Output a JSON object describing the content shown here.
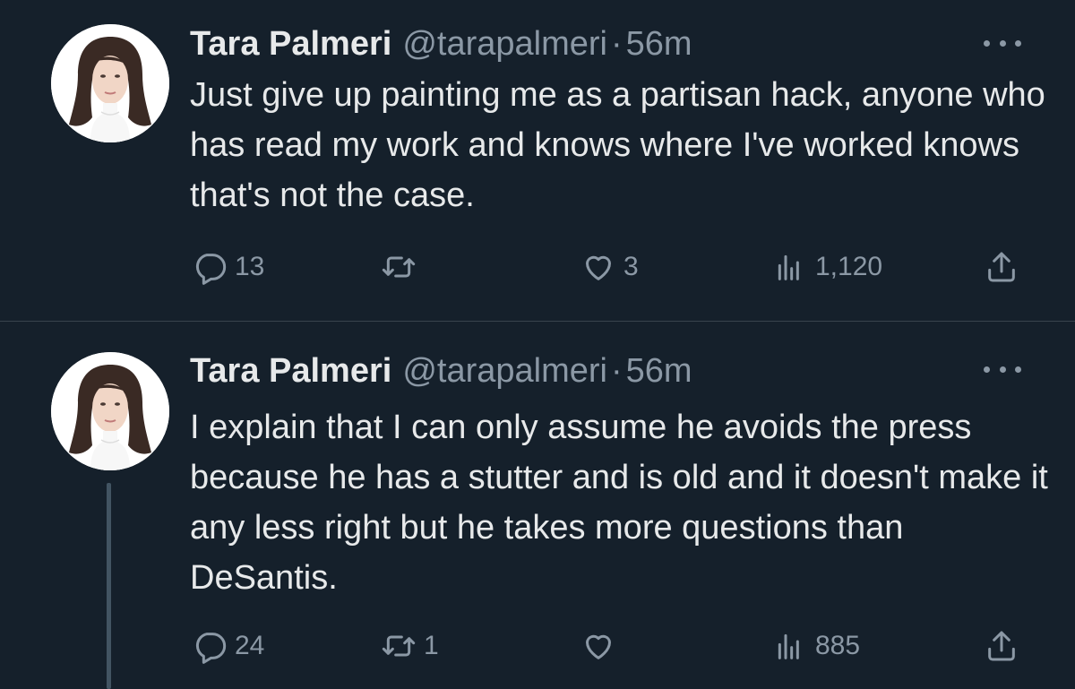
{
  "tweets": [
    {
      "name": "Tara Palmeri",
      "handle": "@tarapalmeri",
      "separator": "·",
      "time": "56m",
      "text": "Just give up painting me as a partisan hack, anyone who has read my work and knows where I've worked knows that's not the case.",
      "replies": "13",
      "retweets": "",
      "likes": "3",
      "views": "1,120"
    },
    {
      "name": "Tara Palmeri",
      "handle": "@tarapalmeri",
      "separator": "·",
      "time": "56m",
      "text": "I explain that I can only assume he avoids the press because he has a stutter and is old and it doesn't make it any less right but he takes more questions than DeSantis.",
      "replies": "24",
      "retweets": "1",
      "likes": "",
      "views": "885"
    }
  ],
  "icons": {
    "reply": "reply-icon",
    "retweet": "retweet-icon",
    "like": "heart-icon",
    "views": "views-icon",
    "share": "share-icon",
    "more": "more-icon"
  },
  "colors": {
    "background": "#15202b",
    "text": "#e7e9ea",
    "secondary": "#8b98a5",
    "divider": "#38444d"
  }
}
